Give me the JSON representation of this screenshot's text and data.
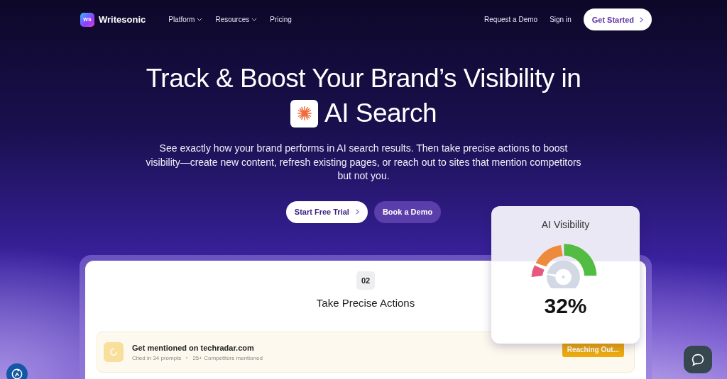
{
  "nav": {
    "brand": "Writesonic",
    "badge": "WS",
    "links": [
      {
        "label": "Platform",
        "dropdown": true
      },
      {
        "label": "Resources",
        "dropdown": true
      },
      {
        "label": "Pricing",
        "dropdown": false
      }
    ],
    "right_links": [
      "Request a Demo",
      "Sign in"
    ],
    "cta": "Get Started"
  },
  "hero": {
    "title_line1": "Track & Boost Your Brand’s Visibility in",
    "title_line2": "AI Search",
    "subtitle": "See exactly how your brand performs in AI search results. Then take precise actions to boost visibility—create new content, refresh existing pages, or reach out to sites that mention competitors but not you.",
    "primary_button": "Start Free Trial",
    "secondary_button": "Book a Demo"
  },
  "panel": {
    "step": "02",
    "title": "Take Precise Actions",
    "actions": [
      {
        "title": "Get mentioned on techradar.com",
        "meta": [
          "Cited in 34 prompts",
          "25+ Competitors mentioned"
        ],
        "status": "Reaching Out..."
      }
    ]
  },
  "visibility_card": {
    "title": "AI Visibility",
    "value": "32%"
  }
}
